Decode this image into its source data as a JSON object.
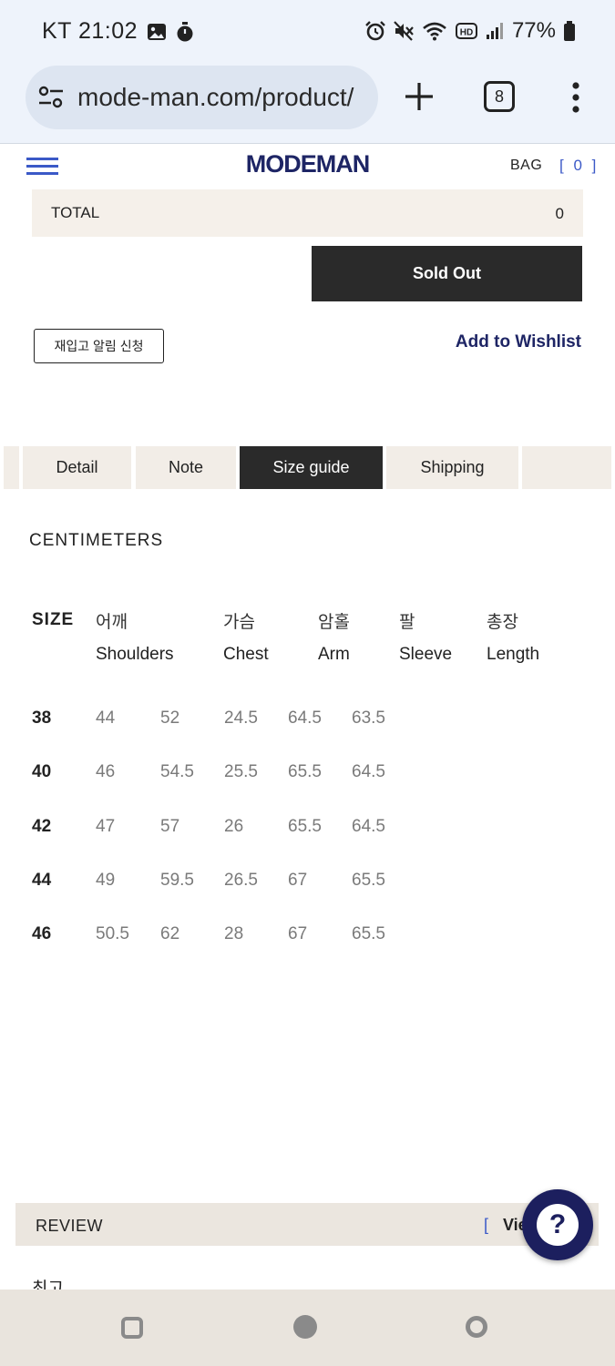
{
  "status_bar": {
    "carrier": "KT",
    "time": "21:02",
    "battery": "77%",
    "icons": [
      "image-icon",
      "timer-icon",
      "alarm-icon",
      "mute-icon",
      "wifi-icon",
      "hd-icon",
      "signal-icon",
      "battery-icon"
    ]
  },
  "browser": {
    "url": "mode-man.com/product/",
    "tab_count": "8"
  },
  "header": {
    "logo": "MODEMAN",
    "bag_label": "BAG",
    "bag_count": "[ 0 ]"
  },
  "purchase": {
    "total_label": "TOTAL",
    "total_value": "0",
    "soldout_label": "Sold Out",
    "restock_label": "재입고 알림 신청",
    "wishlist_label": "Add to Wishlist"
  },
  "tabs": [
    {
      "label": "",
      "active": false
    },
    {
      "label": "Detail",
      "active": false
    },
    {
      "label": "Note",
      "active": false
    },
    {
      "label": "Size guide",
      "active": true
    },
    {
      "label": "Shipping",
      "active": false
    },
    {
      "label": "",
      "active": false
    }
  ],
  "size_guide": {
    "unit": "CENTIMETERS",
    "size_header": "SIZE",
    "columns": [
      {
        "kr": "어깨",
        "en": "Shoulders"
      },
      {
        "kr": "가슴",
        "en": "Chest"
      },
      {
        "kr": "암홀",
        "en": "Arm"
      },
      {
        "kr": "팔",
        "en": "Sleeve"
      },
      {
        "kr": "총장",
        "en": "Length"
      }
    ],
    "rows": [
      {
        "size": "38",
        "values": [
          "44",
          "52",
          "24.5",
          "64.5",
          "63.5"
        ]
      },
      {
        "size": "40",
        "values": [
          "46",
          "54.5",
          "25.5",
          "65.5",
          "64.5"
        ]
      },
      {
        "size": "42",
        "values": [
          "47",
          "57",
          "26",
          "65.5",
          "64.5"
        ]
      },
      {
        "size": "44",
        "values": [
          "49",
          "59.5",
          "26.5",
          "67",
          "65.5"
        ]
      },
      {
        "size": "46",
        "values": [
          "50.5",
          "62",
          "28",
          "67",
          "65.5"
        ]
      }
    ]
  },
  "review": {
    "label": "REVIEW",
    "bracket": "[",
    "view_label": "Vie",
    "snippet": "최고"
  },
  "help_button": {
    "label": "?"
  },
  "colors": {
    "accent_blue": "#3b59c7",
    "logo_navy": "#1e2565",
    "dark_button": "#2a2a2a",
    "beige": "#f5f0ea"
  }
}
